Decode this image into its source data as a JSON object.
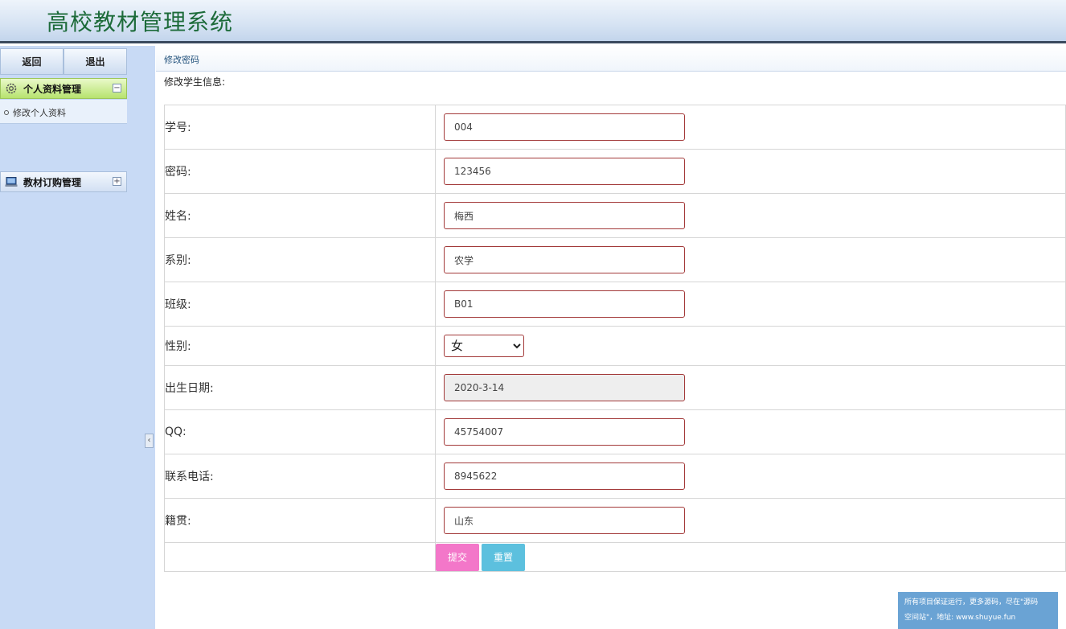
{
  "header": {
    "title": "高校教材管理系统"
  },
  "sidebar": {
    "back_label": "返回",
    "logout_label": "退出",
    "menus": [
      {
        "label": "个人资料管理",
        "icon": "gear-icon",
        "toggle": "−",
        "items": [
          "修改个人资料"
        ]
      },
      {
        "label": "教材订购管理",
        "icon": "laptop-icon",
        "toggle": "+"
      }
    ],
    "collapse_glyph": "‹"
  },
  "main": {
    "panel_title": "修改密码",
    "form_caption": "修改学生信息:",
    "fields": {
      "student_id": {
        "label": "学号:",
        "value": "004"
      },
      "password": {
        "label": "密码:",
        "value": "123456"
      },
      "name": {
        "label": "姓名:",
        "value": "梅西"
      },
      "department": {
        "label": "系别:",
        "value": "农学"
      },
      "class": {
        "label": "班级:",
        "value": "B01"
      },
      "gender": {
        "label": "性别:",
        "value": "女"
      },
      "birth_date": {
        "label": "出生日期:",
        "value": "2020-3-14"
      },
      "qq": {
        "label": "QQ:",
        "value": "45754007"
      },
      "phone": {
        "label": "联系电话:",
        "value": "8945622"
      },
      "hometown": {
        "label": "籍贯:",
        "value": "山东"
      }
    },
    "submit_label": "提交",
    "reset_label": "重置"
  },
  "watermark": {
    "line1": "所有项目保证运行，更多源码，尽在\"源码",
    "line2": "空间站\"，地址: www.shuyue.fun"
  },
  "colors": {
    "title_green": "#1d6b3a",
    "input_border": "#a33a3a",
    "submit_pink": "#f377c9",
    "reset_blue": "#5cc0de",
    "sidebar_bg": "#c8daf5"
  }
}
